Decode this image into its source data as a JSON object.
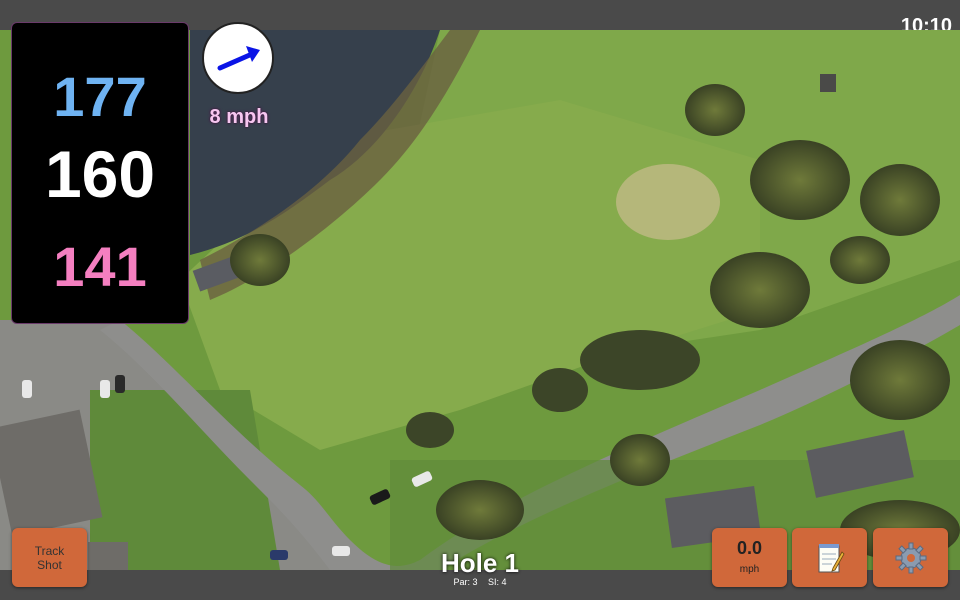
{
  "status_bar": {
    "time": "10:10"
  },
  "distances": {
    "back": "177",
    "middle": "160",
    "front": "141"
  },
  "wind": {
    "speed": "8 mph",
    "direction_icon": "arrow-icon",
    "arrow_color": "#0a14e6"
  },
  "hole": {
    "title": "Hole 1",
    "par": "Par: 3",
    "stroke_index": "SI: 4"
  },
  "buttons": {
    "track_shot_line1": "Track",
    "track_shot_line2": "Shot",
    "speed_value": "0.0",
    "speed_unit": "mph",
    "notes_icon": "notepad-icon",
    "settings_icon": "gear-icon"
  },
  "colors": {
    "back_distance": "#6fb3f2",
    "middle_distance": "#ffffff",
    "front_distance": "#f47fc0",
    "button": "#d0683a",
    "bar": "#4a4a4a"
  }
}
